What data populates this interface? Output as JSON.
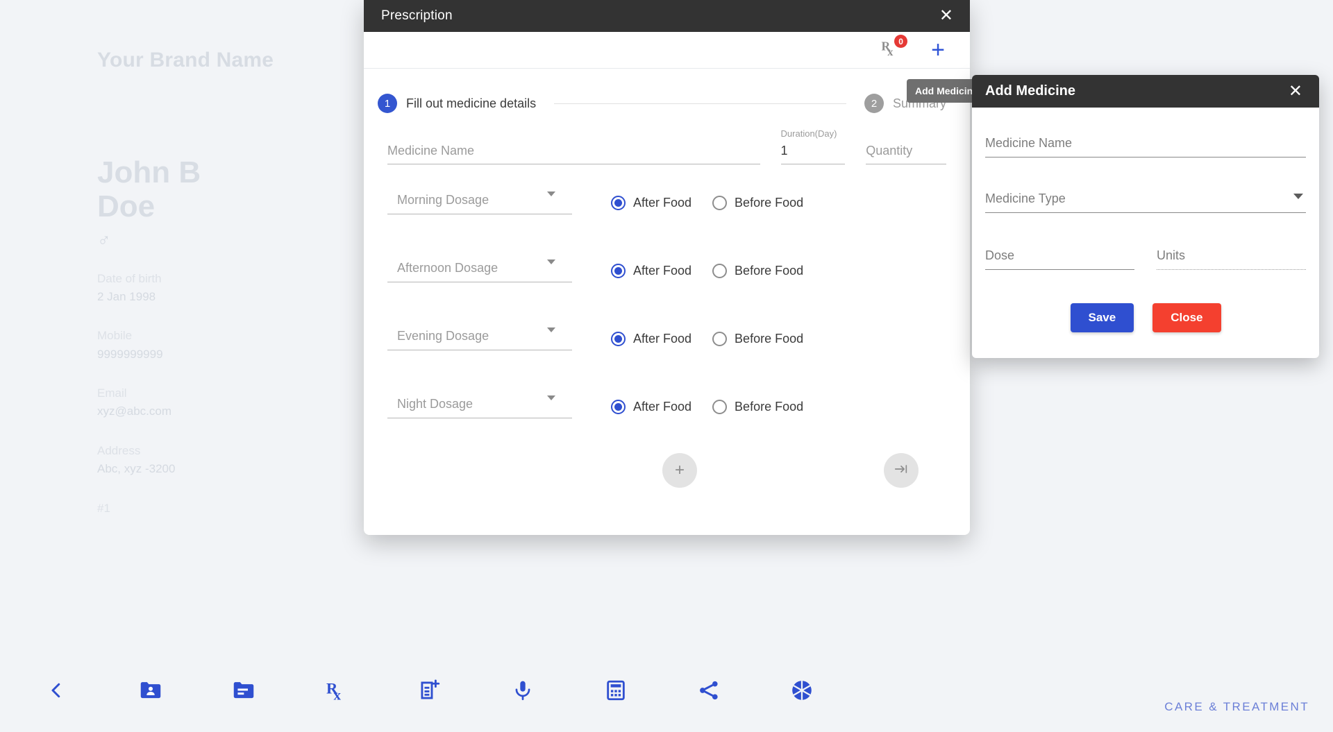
{
  "patient": {
    "brand_name": "Your Brand Name",
    "name": "John B Doe",
    "gender_icon": "male-symbol",
    "gender_glyph": "♂",
    "dob_label": "Date of birth",
    "dob_value": "2 Jan 1998",
    "mobile_label": "Mobile",
    "mobile_value": "9999999999",
    "email_label": "Email",
    "email_value": "xyz@abc.com",
    "address_label": "Address",
    "address_value": "Abc, xyz -3200",
    "index_label": "#1"
  },
  "toolbar": {
    "items": [
      {
        "icon": "back-chevron-icon",
        "name": "back-button"
      },
      {
        "icon": "folder-person-icon",
        "name": "patient-records-button"
      },
      {
        "icon": "folder-notes-icon",
        "name": "notes-folder-button"
      },
      {
        "icon": "rx-icon",
        "name": "prescription-button"
      },
      {
        "icon": "note-add-icon",
        "name": "add-note-button"
      },
      {
        "icon": "microphone-icon",
        "name": "voice-note-button"
      },
      {
        "icon": "calculator-icon",
        "name": "calculator-button"
      },
      {
        "icon": "share-icon",
        "name": "share-button"
      },
      {
        "icon": "aperture-icon",
        "name": "camera-button"
      }
    ],
    "footer_text": "CARE & TREATMENT"
  },
  "prescription_dialog": {
    "title": "Prescription",
    "close_glyph": "✕",
    "rx_badge_count": "0",
    "rx_icon_label": "rx-icon",
    "add_glyph": "+",
    "steps": [
      {
        "number": "1",
        "label": "Fill out medicine details",
        "state": "active"
      },
      {
        "number": "2",
        "label": "Summary",
        "state": "inactive"
      }
    ],
    "fields": {
      "medicine_name_placeholder": "Medicine Name",
      "medicine_name_value": "",
      "duration_label": "Duration(Day)",
      "duration_value": "1",
      "quantity_placeholder": "Quantity",
      "quantity_value": ""
    },
    "dosage_rows": [
      {
        "placeholder": "Morning Dosage",
        "value": "",
        "after_food_label": "After Food",
        "before_food_label": "Before Food",
        "selected": "after"
      },
      {
        "placeholder": "Afternoon Dosage",
        "value": "",
        "after_food_label": "After Food",
        "before_food_label": "Before Food",
        "selected": "after"
      },
      {
        "placeholder": "Evening Dosage",
        "value": "",
        "after_food_label": "After Food",
        "before_food_label": "Before Food",
        "selected": "after"
      },
      {
        "placeholder": "Night Dosage",
        "value": "",
        "after_food_label": "After Food",
        "before_food_label": "Before Food",
        "selected": "after"
      }
    ],
    "add_row_glyph": "+",
    "next_glyph": "→|"
  },
  "tooltip": {
    "text": "Add Medicine"
  },
  "add_medicine_dialog": {
    "title": "Add Medicine",
    "close_glyph": "✕",
    "medicine_name_placeholder": "Medicine Name",
    "medicine_type_placeholder": "Medicine Type",
    "dose_placeholder": "Dose",
    "units_placeholder": "Units",
    "save_label": "Save",
    "close_label": "Close"
  },
  "colors": {
    "accent_blue": "#2f4fd0",
    "danger_red": "#f4402f",
    "titlebar_dark": "#333333",
    "badge_red": "#e53935",
    "page_bg": "#f2f4f7"
  }
}
